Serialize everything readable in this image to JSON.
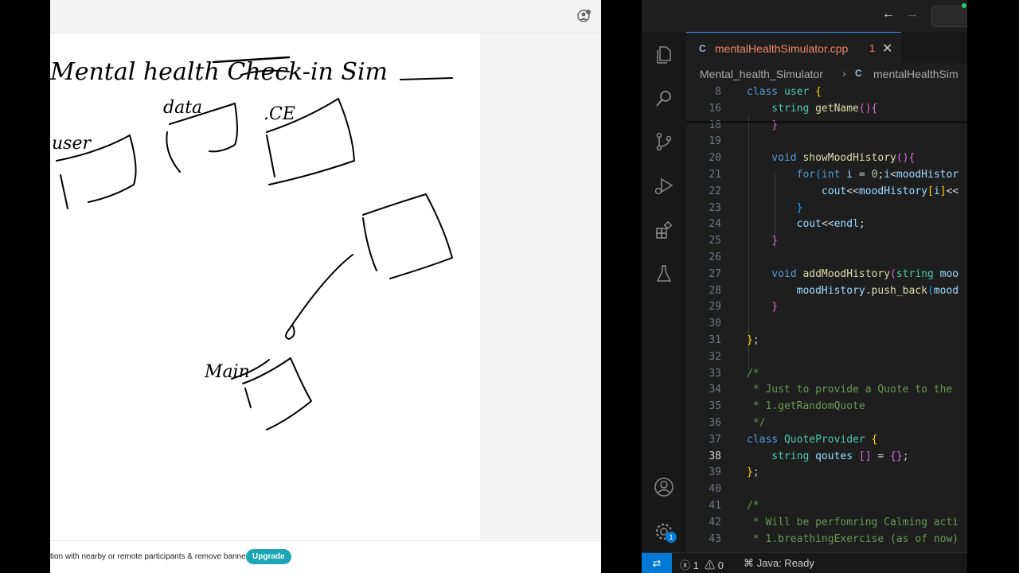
{
  "whiteboard": {
    "banner_text": "tion with nearby or remote participants & remove banner.",
    "upgrade_label": "Upgrade",
    "sketch": {
      "title": "Mental health Check-in Sim",
      "scribble_1": "user",
      "scribble_2": "data",
      "scribble_3": ".CE",
      "scribble_4": "Main"
    }
  },
  "vscode": {
    "tab": {
      "filename": "mentalHealthSimulator.cpp",
      "problems": "1",
      "close_glyph": "✕",
      "lang_glyph": "C"
    },
    "breadcrumb": {
      "folder": "Mental_health_Simulator",
      "separator": "›",
      "file": "mentalHealthSim"
    },
    "lines": [
      {
        "n": "8",
        "parts": [
          [
            "kw",
            "class "
          ],
          [
            "ty",
            "user "
          ],
          [
            "br1",
            "{"
          ]
        ]
      },
      {
        "n": "16",
        "parts": [
          [
            "ty",
            "    string "
          ],
          [
            "fn",
            "getName"
          ],
          [
            "br2",
            "()"
          ],
          [
            "br2",
            "{"
          ]
        ]
      },
      {
        "n": "18",
        "parts": [
          [
            "br2",
            "    }"
          ]
        ]
      },
      {
        "n": "19",
        "parts": []
      },
      {
        "n": "20",
        "parts": [
          [
            "kw",
            "    void "
          ],
          [
            "fn",
            "showMoodHistory"
          ],
          [
            "br2",
            "()"
          ],
          [
            "br2",
            "{"
          ]
        ]
      },
      {
        "n": "21",
        "parts": [
          [
            "",
            "        "
          ],
          [
            "kw",
            "for"
          ],
          [
            "br3",
            "("
          ],
          [
            "kw",
            "int "
          ],
          [
            "var",
            "i "
          ],
          [
            "",
            "= "
          ],
          [
            "num",
            "0"
          ],
          [
            "",
            ";"
          ],
          [
            "var",
            "i"
          ],
          [
            "",
            "<"
          ],
          [
            "var",
            "moodHistor"
          ]
        ]
      },
      {
        "n": "22",
        "parts": [
          [
            "",
            "            "
          ],
          [
            "var",
            "cout"
          ],
          [
            "",
            "<<"
          ],
          [
            "var",
            "moodHistory"
          ],
          [
            "br1",
            "["
          ],
          [
            "var",
            "i"
          ],
          [
            "br1",
            "]"
          ],
          [
            "",
            "<<"
          ]
        ]
      },
      {
        "n": "23",
        "parts": [
          [
            "br3",
            "        }"
          ]
        ]
      },
      {
        "n": "24",
        "parts": [
          [
            "",
            "        "
          ],
          [
            "var",
            "cout"
          ],
          [
            "",
            "<<"
          ],
          [
            "var",
            "endl"
          ],
          [
            "",
            ";"
          ]
        ]
      },
      {
        "n": "25",
        "parts": [
          [
            "br2",
            "    }"
          ]
        ]
      },
      {
        "n": "26",
        "parts": []
      },
      {
        "n": "27",
        "parts": [
          [
            "kw",
            "    void "
          ],
          [
            "fn",
            "addMoodHistory"
          ],
          [
            "br2",
            "("
          ],
          [
            "ty",
            "string "
          ],
          [
            "var",
            "moo"
          ]
        ]
      },
      {
        "n": "28",
        "parts": [
          [
            "",
            "        "
          ],
          [
            "var",
            "moodHistory"
          ],
          [
            "",
            "."
          ],
          [
            "fn",
            "push_back"
          ],
          [
            "br3",
            "("
          ],
          [
            "var",
            "mood"
          ]
        ]
      },
      {
        "n": "29",
        "parts": [
          [
            "br2",
            "    }"
          ]
        ]
      },
      {
        "n": "30",
        "parts": []
      },
      {
        "n": "31",
        "parts": [
          [
            "br1",
            "}"
          ],
          [
            "",
            ";"
          ]
        ]
      },
      {
        "n": "32",
        "parts": []
      },
      {
        "n": "33",
        "parts": [
          [
            "cm",
            "/*"
          ]
        ]
      },
      {
        "n": "34",
        "parts": [
          [
            "cm",
            " * Just to provide a Quote to the"
          ]
        ]
      },
      {
        "n": "35",
        "parts": [
          [
            "cm",
            " * 1.getRandomQuote"
          ]
        ]
      },
      {
        "n": "36",
        "parts": [
          [
            "cm",
            " */"
          ]
        ]
      },
      {
        "n": "37",
        "parts": [
          [
            "kw",
            "class "
          ],
          [
            "ty",
            "QuoteProvider "
          ],
          [
            "br1",
            "{"
          ]
        ]
      },
      {
        "n": "38",
        "parts": [
          [
            "ty",
            "    string "
          ],
          [
            "var",
            "qoutes "
          ],
          [
            "br2",
            "[] "
          ],
          [
            "",
            "= "
          ],
          [
            "br2",
            "{}"
          ],
          [
            "",
            ";"
          ]
        ]
      },
      {
        "n": "39",
        "parts": [
          [
            "br1",
            "}"
          ],
          [
            "",
            ";"
          ]
        ]
      },
      {
        "n": "40",
        "parts": []
      },
      {
        "n": "41",
        "parts": [
          [
            "cm",
            "/*"
          ]
        ]
      },
      {
        "n": "42",
        "parts": [
          [
            "cm",
            " * Will be perfomring Calming acti"
          ]
        ]
      },
      {
        "n": "43",
        "parts": [
          [
            "cm",
            " * 1.breathingExercise (as of now)"
          ]
        ]
      }
    ],
    "status": {
      "errors": "1",
      "warnings": "0",
      "java_status": "Java: Ready",
      "gear_badge": "1"
    }
  }
}
